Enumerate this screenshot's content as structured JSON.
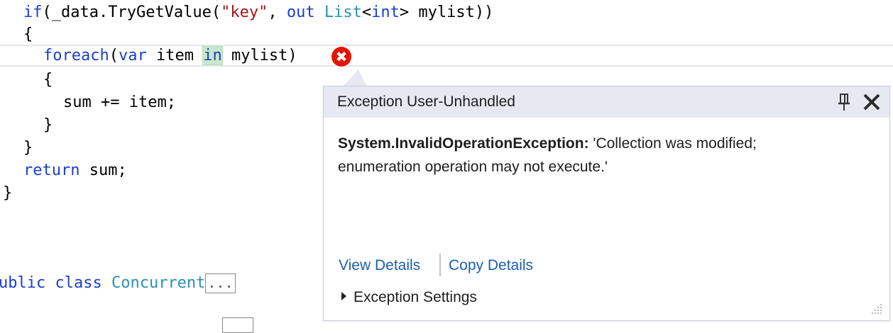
{
  "code": {
    "line1": {
      "kw_if": "if",
      "pre": "(_data.TryGetValue(",
      "str_key": "\"key\"",
      "comma": ", ",
      "kw_out": "out",
      "sp": " ",
      "type_list": "List",
      "lt": "<",
      "kw_int": "int",
      "rest": "> mylist))"
    },
    "line2": "{",
    "line3": {
      "kw_foreach": "foreach",
      "paren_open": "(",
      "kw_var": "var",
      "mid": " item ",
      "kw_in": "in",
      "rest": " mylist)"
    },
    "line4": "{",
    "line5": "sum += item;",
    "line6": "}",
    "line7": "}",
    "line8": {
      "kw_return": "return",
      "rest": " sum;"
    },
    "line9": "}",
    "line10": {
      "kw_public_partial": "ublic",
      "sp1": " ",
      "kw_class": "class",
      "sp2": " ",
      "type_name": "Concurrent",
      "collapsed": "..."
    }
  },
  "popup": {
    "title": "Exception User-Unhandled",
    "exception_type": "System.InvalidOperationException:",
    "message_line1": " 'Collection was modified;",
    "message_line2": "enumeration operation may not execute.'",
    "view_details": "View Details",
    "copy_details": "Copy Details",
    "exception_settings": "Exception Settings"
  },
  "error_glyph": "✖",
  "colors": {
    "keyword": "#1a3fcc",
    "type": "#2b91af",
    "string": "#a31515",
    "error": "#e51400",
    "popup_header": "#e6e9f2",
    "link": "#1a5fb4"
  },
  "icons": [
    "error-icon",
    "pin-icon",
    "close-icon",
    "expand-arrow-icon",
    "resize-grip-icon"
  ]
}
